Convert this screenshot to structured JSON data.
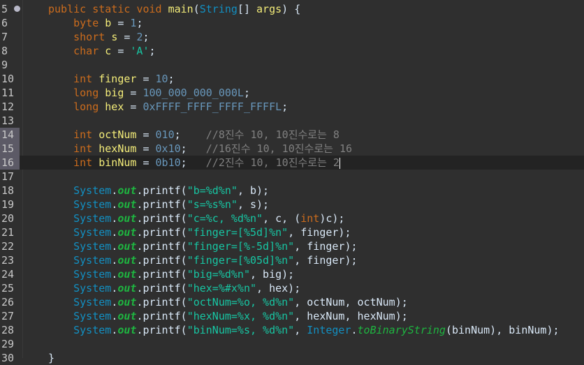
{
  "editor": {
    "language": "java",
    "current_line": 16,
    "breakpoint_line": 5,
    "highlighted_lines": [
      14,
      15,
      16
    ],
    "lines": [
      {
        "n": "5",
        "tokens": [
          [
            "kw",
            "public"
          ],
          [
            "pl",
            " "
          ],
          [
            "kw",
            "static"
          ],
          [
            "pl",
            " "
          ],
          [
            "kw",
            "void"
          ],
          [
            "pl",
            " "
          ],
          [
            "id",
            "main"
          ],
          [
            "pl",
            "("
          ],
          [
            "cls",
            "String"
          ],
          [
            "pl",
            "[] "
          ],
          [
            "id",
            "args"
          ],
          [
            "pl",
            ") {"
          ]
        ]
      },
      {
        "n": "6",
        "tokens": [
          [
            "pl",
            "    "
          ],
          [
            "kw",
            "byte"
          ],
          [
            "pl",
            " "
          ],
          [
            "id",
            "b"
          ],
          [
            "pl",
            " = "
          ],
          [
            "num",
            "1"
          ],
          [
            "pl",
            ";"
          ]
        ]
      },
      {
        "n": "7",
        "tokens": [
          [
            "pl",
            "    "
          ],
          [
            "kw",
            "short"
          ],
          [
            "pl",
            " "
          ],
          [
            "id",
            "s"
          ],
          [
            "pl",
            " = "
          ],
          [
            "num",
            "2"
          ],
          [
            "pl",
            ";"
          ]
        ]
      },
      {
        "n": "8",
        "tokens": [
          [
            "pl",
            "    "
          ],
          [
            "kw",
            "char"
          ],
          [
            "pl",
            " "
          ],
          [
            "id",
            "c"
          ],
          [
            "pl",
            " = "
          ],
          [
            "str",
            "'A'"
          ],
          [
            "pl",
            ";"
          ]
        ]
      },
      {
        "n": "9",
        "tokens": []
      },
      {
        "n": "10",
        "tokens": [
          [
            "pl",
            "    "
          ],
          [
            "kw",
            "int"
          ],
          [
            "pl",
            " "
          ],
          [
            "id",
            "finger"
          ],
          [
            "pl",
            " = "
          ],
          [
            "num",
            "10"
          ],
          [
            "pl",
            ";"
          ]
        ]
      },
      {
        "n": "11",
        "tokens": [
          [
            "pl",
            "    "
          ],
          [
            "kw",
            "long"
          ],
          [
            "pl",
            " "
          ],
          [
            "id",
            "big"
          ],
          [
            "pl",
            " = "
          ],
          [
            "num",
            "100_000_000_000L"
          ],
          [
            "pl",
            ";"
          ]
        ]
      },
      {
        "n": "12",
        "tokens": [
          [
            "pl",
            "    "
          ],
          [
            "kw",
            "long"
          ],
          [
            "pl",
            " "
          ],
          [
            "id",
            "hex"
          ],
          [
            "pl",
            " = "
          ],
          [
            "num",
            "0xFFFF_FFFF_FFFF_FFFFL"
          ],
          [
            "pl",
            ";"
          ]
        ]
      },
      {
        "n": "13",
        "tokens": []
      },
      {
        "n": "14",
        "tokens": [
          [
            "pl",
            "    "
          ],
          [
            "kw",
            "int"
          ],
          [
            "pl",
            " "
          ],
          [
            "id",
            "octNum"
          ],
          [
            "pl",
            " = "
          ],
          [
            "num",
            "010"
          ],
          [
            "pl",
            ";    "
          ],
          [
            "cmt",
            "//8진수 10, 10진수로는 8"
          ]
        ]
      },
      {
        "n": "15",
        "tokens": [
          [
            "pl",
            "    "
          ],
          [
            "kw",
            "int"
          ],
          [
            "pl",
            " "
          ],
          [
            "id",
            "hexNum"
          ],
          [
            "pl",
            " = "
          ],
          [
            "num",
            "0x10"
          ],
          [
            "pl",
            ";   "
          ],
          [
            "cmt",
            "//16진수 10, 10진수로는 16"
          ]
        ]
      },
      {
        "n": "16",
        "tokens": [
          [
            "pl",
            "    "
          ],
          [
            "kw",
            "int"
          ],
          [
            "pl",
            " "
          ],
          [
            "id",
            "binNum"
          ],
          [
            "pl",
            " = "
          ],
          [
            "num",
            "0b10"
          ],
          [
            "pl",
            ";   "
          ],
          [
            "cmt",
            "//2진수 10, 10진수로는 2"
          ]
        ]
      },
      {
        "n": "17",
        "tokens": []
      },
      {
        "n": "18",
        "tokens": [
          [
            "pl",
            "    "
          ],
          [
            "cls",
            "System"
          ],
          [
            "pl",
            "."
          ],
          [
            "static",
            "out"
          ],
          [
            "pl",
            "."
          ],
          [
            "pl",
            "printf("
          ],
          [
            "str",
            "\"b=%d%n\""
          ],
          [
            "pl",
            ", b);"
          ]
        ]
      },
      {
        "n": "19",
        "tokens": [
          [
            "pl",
            "    "
          ],
          [
            "cls",
            "System"
          ],
          [
            "pl",
            "."
          ],
          [
            "static",
            "out"
          ],
          [
            "pl",
            "."
          ],
          [
            "pl",
            "printf("
          ],
          [
            "str",
            "\"s=%s%n\""
          ],
          [
            "pl",
            ", s);"
          ]
        ]
      },
      {
        "n": "20",
        "tokens": [
          [
            "pl",
            "    "
          ],
          [
            "cls",
            "System"
          ],
          [
            "pl",
            "."
          ],
          [
            "static",
            "out"
          ],
          [
            "pl",
            "."
          ],
          [
            "pl",
            "printf("
          ],
          [
            "str",
            "\"c=%c, %d%n\""
          ],
          [
            "pl",
            ", c, ("
          ],
          [
            "kw",
            "int"
          ],
          [
            "pl",
            ")c);"
          ]
        ]
      },
      {
        "n": "21",
        "tokens": [
          [
            "pl",
            "    "
          ],
          [
            "cls",
            "System"
          ],
          [
            "pl",
            "."
          ],
          [
            "static",
            "out"
          ],
          [
            "pl",
            "."
          ],
          [
            "pl",
            "printf("
          ],
          [
            "str",
            "\"finger=[%5d]%n\""
          ],
          [
            "pl",
            ", finger);"
          ]
        ]
      },
      {
        "n": "22",
        "tokens": [
          [
            "pl",
            "    "
          ],
          [
            "cls",
            "System"
          ],
          [
            "pl",
            "."
          ],
          [
            "static",
            "out"
          ],
          [
            "pl",
            "."
          ],
          [
            "pl",
            "printf("
          ],
          [
            "str",
            "\"finger=[%-5d]%n\""
          ],
          [
            "pl",
            ", finger);"
          ]
        ]
      },
      {
        "n": "23",
        "tokens": [
          [
            "pl",
            "    "
          ],
          [
            "cls",
            "System"
          ],
          [
            "pl",
            "."
          ],
          [
            "static",
            "out"
          ],
          [
            "pl",
            "."
          ],
          [
            "pl",
            "printf("
          ],
          [
            "str",
            "\"finger=[%05d]%n\""
          ],
          [
            "pl",
            ", finger);"
          ]
        ]
      },
      {
        "n": "24",
        "tokens": [
          [
            "pl",
            "    "
          ],
          [
            "cls",
            "System"
          ],
          [
            "pl",
            "."
          ],
          [
            "static",
            "out"
          ],
          [
            "pl",
            "."
          ],
          [
            "pl",
            "printf("
          ],
          [
            "str",
            "\"big=%d%n\""
          ],
          [
            "pl",
            ", big);"
          ]
        ]
      },
      {
        "n": "25",
        "tokens": [
          [
            "pl",
            "    "
          ],
          [
            "cls",
            "System"
          ],
          [
            "pl",
            "."
          ],
          [
            "static",
            "out"
          ],
          [
            "pl",
            "."
          ],
          [
            "pl",
            "printf("
          ],
          [
            "str",
            "\"hex=%#x%n\""
          ],
          [
            "pl",
            ", hex);"
          ]
        ]
      },
      {
        "n": "26",
        "tokens": [
          [
            "pl",
            "    "
          ],
          [
            "cls",
            "System"
          ],
          [
            "pl",
            "."
          ],
          [
            "static",
            "out"
          ],
          [
            "pl",
            "."
          ],
          [
            "pl",
            "printf("
          ],
          [
            "str",
            "\"octNum=%o, %d%n\""
          ],
          [
            "pl",
            ", octNum, octNum);"
          ]
        ]
      },
      {
        "n": "27",
        "tokens": [
          [
            "pl",
            "    "
          ],
          [
            "cls",
            "System"
          ],
          [
            "pl",
            "."
          ],
          [
            "static",
            "out"
          ],
          [
            "pl",
            "."
          ],
          [
            "pl",
            "printf("
          ],
          [
            "str",
            "\"hexNum=%x, %d%n\""
          ],
          [
            "pl",
            ", hexNum, hexNum);"
          ]
        ]
      },
      {
        "n": "28",
        "tokens": [
          [
            "pl",
            "    "
          ],
          [
            "cls",
            "System"
          ],
          [
            "pl",
            "."
          ],
          [
            "static",
            "out"
          ],
          [
            "pl",
            "."
          ],
          [
            "pl",
            "printf("
          ],
          [
            "str",
            "\"binNum=%s, %d%n\""
          ],
          [
            "pl",
            ", "
          ],
          [
            "cls",
            "Integer"
          ],
          [
            "pl",
            "."
          ],
          [
            "smethod",
            "toBinaryString"
          ],
          [
            "pl",
            "(binNum), binNum);"
          ]
        ]
      },
      {
        "n": "29",
        "tokens": []
      },
      {
        "n": "30",
        "tokens": [
          [
            "pl",
            "}"
          ]
        ]
      }
    ]
  }
}
